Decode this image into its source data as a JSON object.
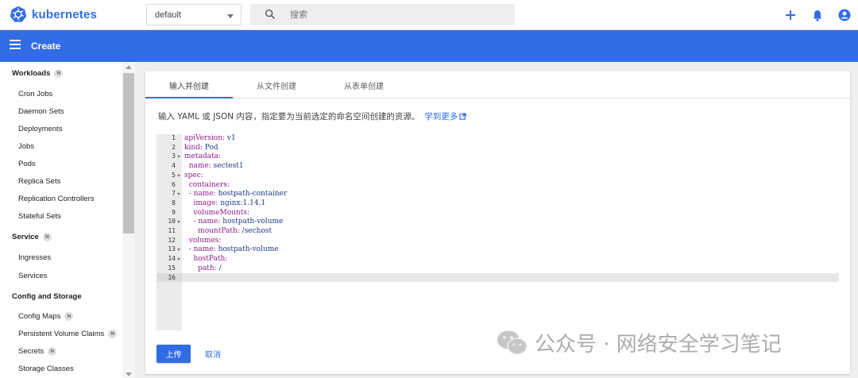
{
  "brand": {
    "name": "kubernetes",
    "color": "#326ce5"
  },
  "namespace": {
    "selected": "default"
  },
  "search": {
    "placeholder": "搜索"
  },
  "top_actions": [
    {
      "icon": "plus-icon"
    },
    {
      "icon": "bell-icon"
    },
    {
      "icon": "account-icon"
    }
  ],
  "header": {
    "title": "Create"
  },
  "sidebar": {
    "sections": [
      {
        "label": "Workloads",
        "badge": "N",
        "items": [
          {
            "label": "Cron Jobs"
          },
          {
            "label": "Daemon Sets"
          },
          {
            "label": "Deployments"
          },
          {
            "label": "Jobs"
          },
          {
            "label": "Pods"
          },
          {
            "label": "Replica Sets"
          },
          {
            "label": "Replication Controllers"
          },
          {
            "label": "Stateful Sets"
          }
        ]
      },
      {
        "label": "Service",
        "badge": "N",
        "items": [
          {
            "label": "Ingresses"
          },
          {
            "label": "Services"
          }
        ]
      },
      {
        "label": "Config and Storage",
        "items": [
          {
            "label": "Config Maps",
            "badge": "N"
          },
          {
            "label": "Persistent Volume Claims",
            "badge": "N"
          },
          {
            "label": "Secrets",
            "badge": "N"
          },
          {
            "label": "Storage Classes"
          }
        ]
      }
    ]
  },
  "tabs": [
    {
      "label": "输入并创建",
      "active": true
    },
    {
      "label": "从文件创建"
    },
    {
      "label": "从表单创建"
    }
  ],
  "description": {
    "text": "输入 YAML 或 JSON 内容，指定要为当前选定的命名空间创建的资源。",
    "link": "学到更多"
  },
  "editor": {
    "lines": [
      {
        "n": "1",
        "key": "apiVersion:",
        "val": " v1",
        "indent": ""
      },
      {
        "n": "2",
        "key": "kind:",
        "val": " Pod",
        "indent": ""
      },
      {
        "n": "3",
        "key": "metadata:",
        "val": "",
        "indent": "",
        "fold": true
      },
      {
        "n": "4",
        "key": "name:",
        "val": " sectest1",
        "indent": "  "
      },
      {
        "n": "5",
        "key": "spec:",
        "val": "",
        "indent": "",
        "fold": true
      },
      {
        "n": "6",
        "key": "containers:",
        "val": "",
        "indent": "  "
      },
      {
        "n": "7",
        "key": "- name:",
        "val": " hostpath-container",
        "indent": "  ",
        "fold": true
      },
      {
        "n": "8",
        "key": "image:",
        "val": " nginx:1.14.1",
        "indent": "    "
      },
      {
        "n": "9",
        "key": "volumeMounts:",
        "val": "",
        "indent": "    "
      },
      {
        "n": "10",
        "key": "- name:",
        "val": " hostpath-volume",
        "indent": "    ",
        "fold": true
      },
      {
        "n": "11",
        "key": "mountPath:",
        "val": " /sechost",
        "indent": "      "
      },
      {
        "n": "12",
        "key": "volumes:",
        "val": "",
        "indent": "  "
      },
      {
        "n": "13",
        "key": "- name:",
        "val": " hostpath-volume",
        "indent": "  ",
        "fold": true
      },
      {
        "n": "14",
        "key": "hostPath:",
        "val": "",
        "indent": "    ",
        "fold": true
      },
      {
        "n": "15",
        "key": "path:",
        "val": " /",
        "indent": "      "
      },
      {
        "n": "16",
        "key": "",
        "val": "",
        "indent": ""
      }
    ]
  },
  "buttons": {
    "upload": "上传",
    "cancel": "取消"
  },
  "watermark": {
    "text": "公众号 · 网络安全学习笔记"
  }
}
